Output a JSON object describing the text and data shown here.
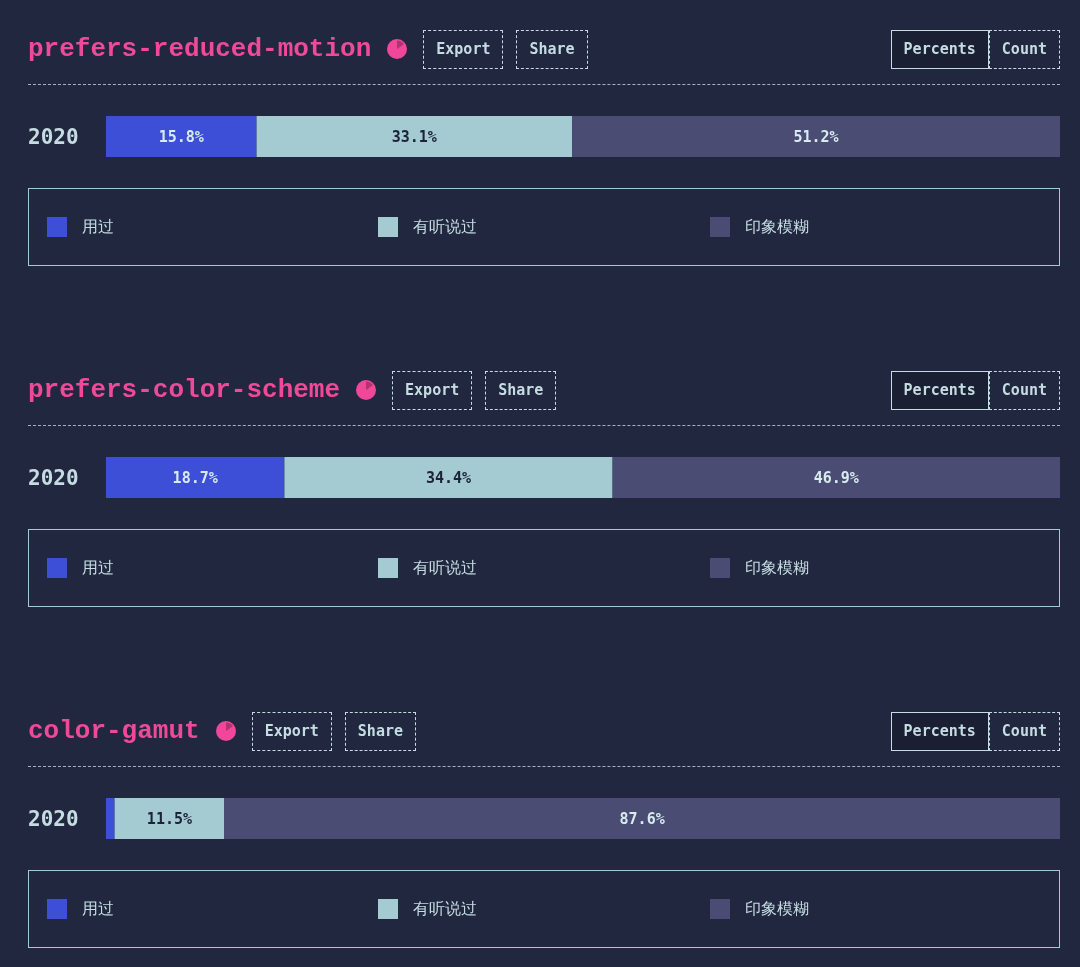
{
  "sections": [
    {
      "title": "prefers-reduced-motion",
      "actions": [
        "Export",
        "Share"
      ],
      "toggle": [
        {
          "label": "Percents",
          "selected": true
        },
        {
          "label": "Count",
          "selected": false
        }
      ],
      "chart_data": {
        "type": "bar",
        "orientation": "horizontal",
        "stacked": true,
        "legend": "bottom",
        "categories": [
          "2020"
        ],
        "series": [
          {
            "name": "用过",
            "color": "#3d4fd6",
            "values": [
              15.8
            ],
            "value_labels": [
              "15.8%"
            ]
          },
          {
            "name": "有听说过",
            "color": "#a3cbd1",
            "values": [
              33.1
            ],
            "value_labels": [
              "33.1%"
            ]
          },
          {
            "name": "印象模糊",
            "color": "#4a4c74",
            "values": [
              51.2
            ],
            "value_labels": [
              "51.2%"
            ]
          }
        ]
      }
    },
    {
      "title": "prefers-color-scheme",
      "actions": [
        "Export",
        "Share"
      ],
      "toggle": [
        {
          "label": "Percents",
          "selected": true
        },
        {
          "label": "Count",
          "selected": false
        }
      ],
      "chart_data": {
        "type": "bar",
        "orientation": "horizontal",
        "stacked": true,
        "legend": "bottom",
        "categories": [
          "2020"
        ],
        "series": [
          {
            "name": "用过",
            "color": "#3d4fd6",
            "values": [
              18.7
            ],
            "value_labels": [
              "18.7%"
            ]
          },
          {
            "name": "有听说过",
            "color": "#a3cbd1",
            "values": [
              34.4
            ],
            "value_labels": [
              "34.4%"
            ]
          },
          {
            "name": "印象模糊",
            "color": "#4a4c74",
            "values": [
              46.9
            ],
            "value_labels": [
              "46.9%"
            ]
          }
        ]
      }
    },
    {
      "title": "color-gamut",
      "actions": [
        "Export",
        "Share"
      ],
      "toggle": [
        {
          "label": "Percents",
          "selected": true
        },
        {
          "label": "Count",
          "selected": false
        }
      ],
      "chart_data": {
        "type": "bar",
        "orientation": "horizontal",
        "stacked": true,
        "legend": "bottom",
        "categories": [
          "2020"
        ],
        "series": [
          {
            "name": "用过",
            "color": "#3d4fd6",
            "values": [
              0.9
            ],
            "value_labels": [
              null
            ]
          },
          {
            "name": "有听说过",
            "color": "#a3cbd1",
            "values": [
              11.5
            ],
            "value_labels": [
              "11.5%"
            ]
          },
          {
            "name": "印象模糊",
            "color": "#4a4c74",
            "values": [
              87.6
            ],
            "value_labels": [
              "87.6%"
            ]
          }
        ]
      }
    }
  ]
}
